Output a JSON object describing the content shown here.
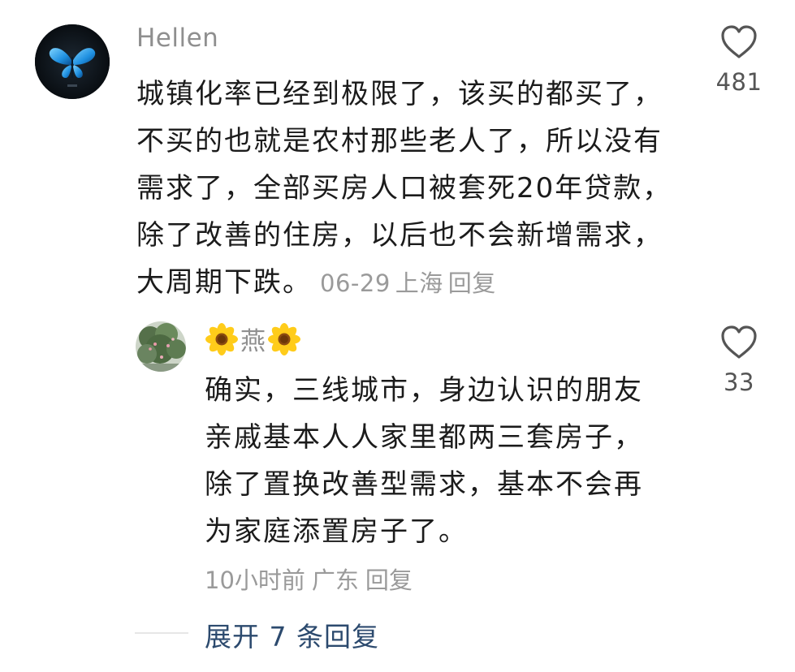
{
  "main_comment": {
    "username": "Hellen",
    "text": "城镇化率已经到极限了，该买的都买了，不买的也就是农村那些老人了，所以没有需求了，全部买房人口被套死20年贷款，除了改善的住房，以后也不会新增需求，大周期下跌。",
    "date": "06-29",
    "location": "上海",
    "reply_label": "回复",
    "like_count": "481"
  },
  "reply_comment": {
    "username": "燕",
    "text": "确实，三线城市，身边认识的朋友亲戚基本人人家里都两三套房子，除了置换改善型需求，基本不会再为家庭添置房子了。",
    "time": "10小时前",
    "location": "广东",
    "reply_label": "回复",
    "like_count": "33"
  },
  "expand_replies_label": "展开 7 条回复",
  "colors": {
    "username": "#8f8f8f",
    "meta": "#9a9a9a",
    "link": "#2c4a6e",
    "text": "#1b1b1b"
  },
  "icons": {
    "like": "heart-outline-icon",
    "avatar_main": "blue-butterfly",
    "username_decoration": "sunflower-emoji"
  }
}
